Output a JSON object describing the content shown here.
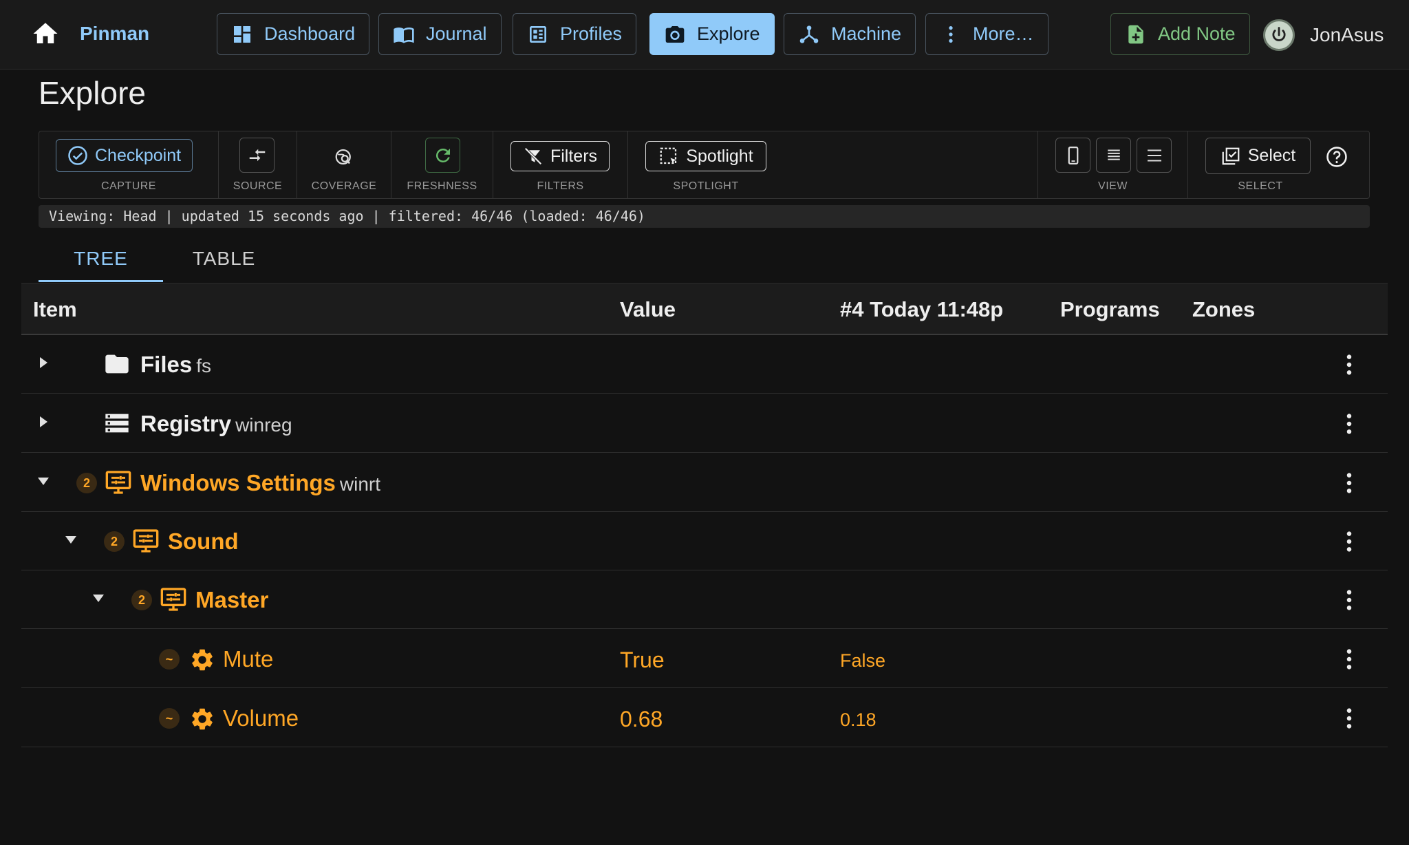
{
  "app": {
    "brand": "Pinman",
    "user": "JonAsus"
  },
  "nav": {
    "dashboard": "Dashboard",
    "journal": "Journal",
    "profiles": "Profiles",
    "explore": "Explore",
    "machine": "Machine",
    "more": "More…",
    "add_note": "Add Note"
  },
  "page": {
    "title": "Explore"
  },
  "toolbar": {
    "checkpoint": "Checkpoint",
    "filters": "Filters",
    "spotlight": "Spotlight",
    "select": "Select",
    "labels": {
      "capture": "CAPTURE",
      "source": "SOURCE",
      "coverage": "COVERAGE",
      "freshness": "FRESHNESS",
      "filters": "FILTERS",
      "spotlight": "SPOTLIGHT",
      "view": "VIEW",
      "select": "SELECT"
    }
  },
  "status": {
    "text": "Viewing: Head | updated 15 seconds ago | filtered: 46/46 (loaded: 46/46)"
  },
  "tabs": {
    "tree": "TREE",
    "table": "TABLE"
  },
  "table": {
    "headers": {
      "item": "Item",
      "value": "Value",
      "snapshot": "#4 Today 11:48p",
      "programs": "Programs",
      "zones": "Zones"
    },
    "rows": [
      {
        "name": "Files",
        "sub": "fs",
        "expanded": false
      },
      {
        "name": "Registry",
        "sub": "winreg",
        "expanded": false
      },
      {
        "name": "Windows Settings",
        "sub": "winrt",
        "badge": "2",
        "expanded": true
      },
      {
        "name": "Sound",
        "badge": "2",
        "expanded": true
      },
      {
        "name": "Master",
        "badge": "2",
        "expanded": true
      },
      {
        "name": "Mute",
        "badge": "~",
        "value": "True",
        "snapshot": "False"
      },
      {
        "name": "Volume",
        "badge": "~",
        "value": "0.68",
        "snapshot": "0.18"
      }
    ]
  },
  "colors": {
    "accent": "#90caf9",
    "changed": "#ffa726",
    "success": "#81c784",
    "background": "#121212"
  }
}
